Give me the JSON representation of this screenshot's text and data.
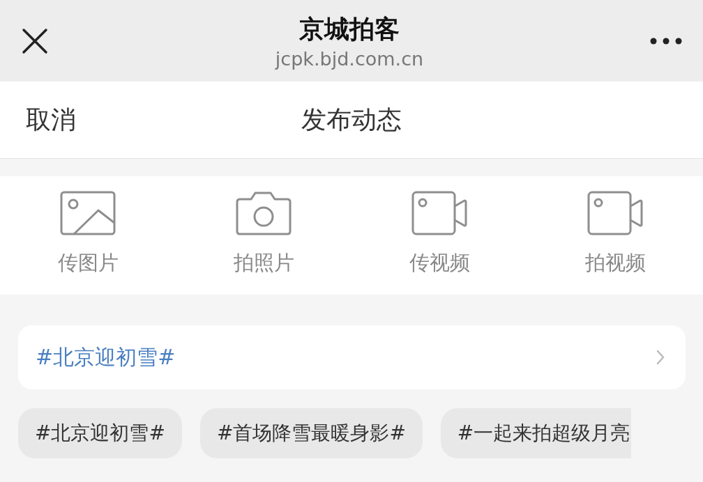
{
  "top_bar": {
    "title": "京城拍客",
    "url": "jcpk.bjd.com.cn"
  },
  "header": {
    "cancel": "取消",
    "title": "发布动态"
  },
  "media_actions": [
    {
      "kind": "image",
      "label": "传图片"
    },
    {
      "kind": "camera",
      "label": "拍照片"
    },
    {
      "kind": "video",
      "label": "传视频"
    },
    {
      "kind": "video",
      "label": "拍视频"
    }
  ],
  "topic": {
    "label": "#北京迎初雪#"
  },
  "topic_chips": [
    "#北京迎初雪#",
    "#首场降雪最暖身影#",
    "#一起来拍超级月亮"
  ]
}
